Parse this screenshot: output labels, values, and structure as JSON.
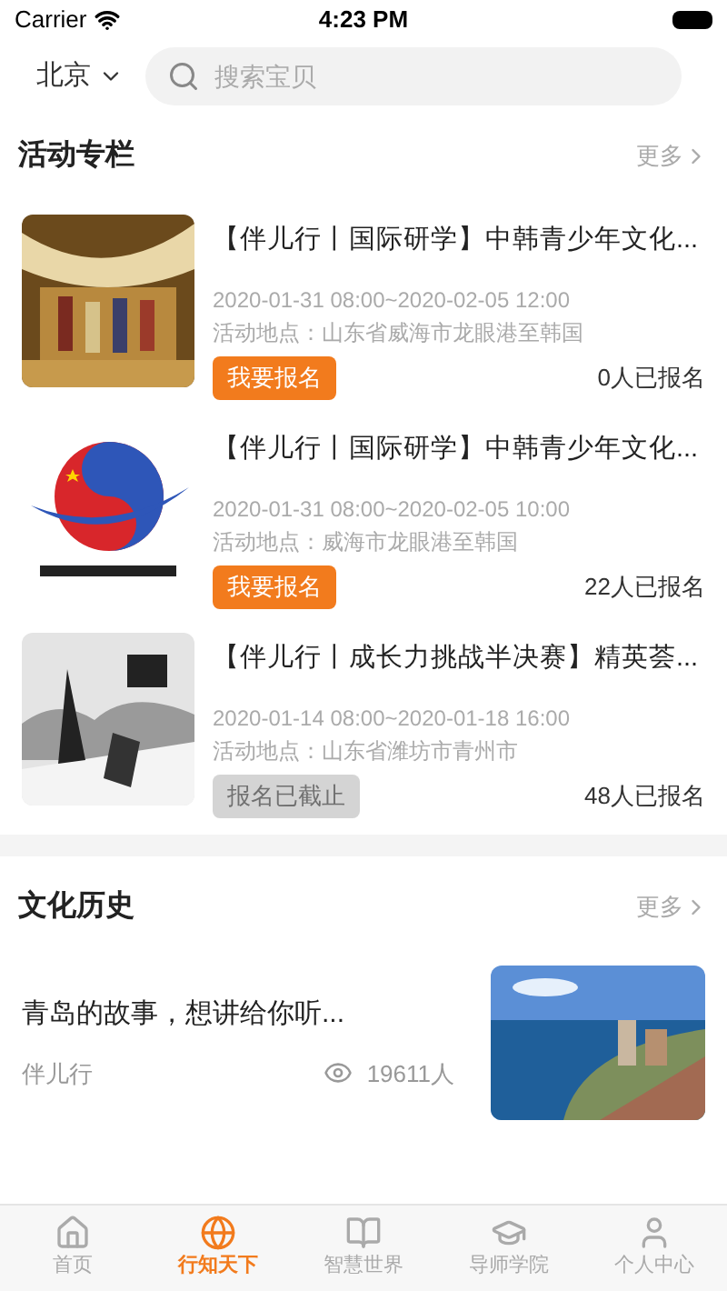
{
  "status_bar": {
    "carrier": "Carrier",
    "time": "4:23 PM"
  },
  "header": {
    "city": "北京",
    "search": {
      "placeholder": "搜索宝贝"
    }
  },
  "activities": {
    "title": "活动专栏",
    "more": "更多",
    "items": [
      {
        "title": "【伴儿行丨国际研学】中韩青少年文化...",
        "time": "2020-01-31 08:00~2020-02-05 12:00",
        "location": "活动地点：山东省威海市龙眼港至韩国",
        "button": "我要报名",
        "closed": false,
        "count": "0人已报名"
      },
      {
        "title": "【伴儿行丨国际研学】中韩青少年文化...",
        "time": "2020-01-31 08:00~2020-02-05 10:00",
        "location": "活动地点：威海市龙眼港至韩国",
        "button": "我要报名",
        "closed": false,
        "count": "22人已报名"
      },
      {
        "title": "【伴儿行丨成长力挑战半决赛】精英荟...",
        "time": "2020-01-14 08:00~2020-01-18 16:00",
        "location": "活动地点：山东省潍坊市青州市",
        "button": "报名已截止",
        "closed": true,
        "count": "48人已报名"
      }
    ]
  },
  "culture": {
    "title": "文化历史",
    "more": "更多",
    "articles": [
      {
        "title": "青岛的故事，想讲给你听...",
        "author": "伴儿行",
        "views": "19611人"
      }
    ]
  },
  "tab_bar": [
    {
      "label": "首页",
      "selected": false
    },
    {
      "label": "行知天下",
      "selected": true
    },
    {
      "label": "智慧世界",
      "selected": false
    },
    {
      "label": "导师学院",
      "selected": false
    },
    {
      "label": "个人中心",
      "selected": false
    }
  ]
}
